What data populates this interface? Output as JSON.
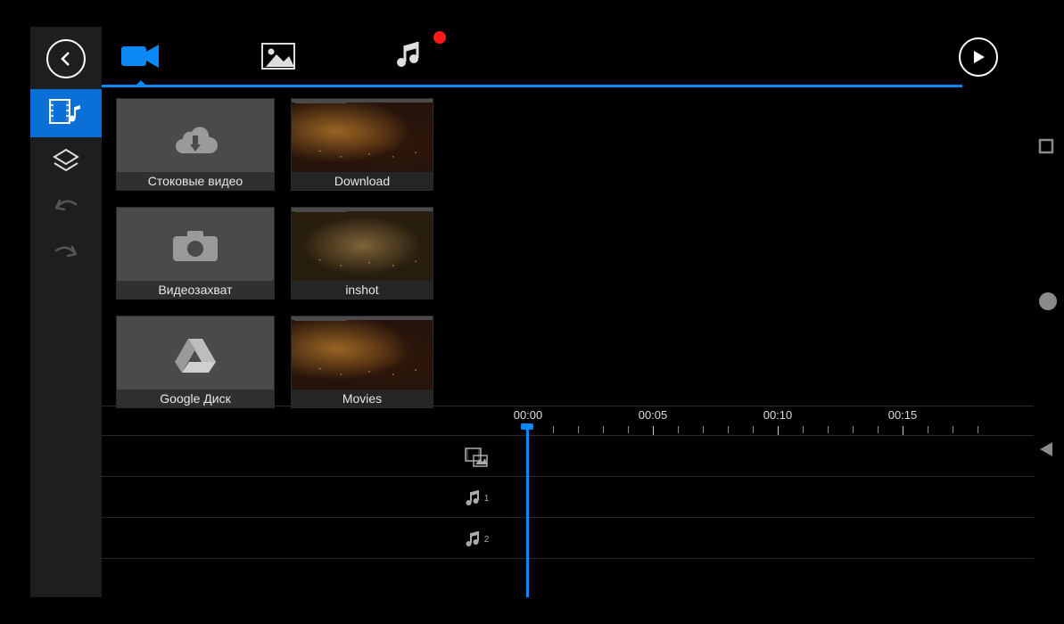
{
  "tabs": {
    "video": "video",
    "image": "image",
    "music": "music"
  },
  "folders": {
    "stock": "Стоковые видео",
    "capture": "Видеозахват",
    "gdrive": "Google Диск"
  },
  "thumbs": {
    "download": "Download",
    "inshot": "inshot",
    "movies": "Movies"
  },
  "timeline": {
    "t0": "00:00",
    "t1": "00:05",
    "t2": "00:10",
    "t3": "00:15",
    "audio1": "1",
    "audio2": "2"
  }
}
